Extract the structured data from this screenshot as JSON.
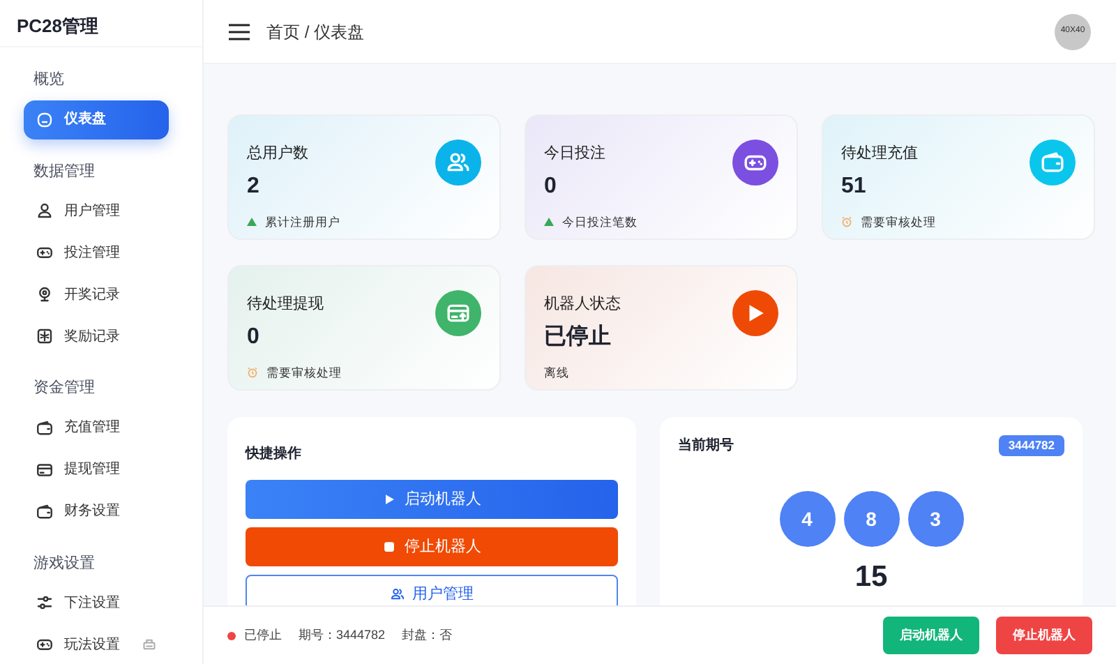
{
  "brand": "PC28管理",
  "sidebar": [
    {
      "title": "概览",
      "items": [
        {
          "label": "仪表盘",
          "selected": true
        }
      ]
    },
    {
      "title": "数据管理",
      "items": [
        {
          "label": "用户管理",
          "selected": false
        },
        {
          "label": "投注管理",
          "selected": false
        },
        {
          "label": "开奖记录",
          "selected": false
        },
        {
          "label": "奖励记录",
          "selected": false
        }
      ]
    },
    {
      "title": "资金管理",
      "items": [
        {
          "label": "充值管理",
          "selected": false
        },
        {
          "label": "提现管理",
          "selected": false
        },
        {
          "label": "财务设置",
          "selected": false
        }
      ]
    },
    {
      "title": "游戏设置",
      "items": [
        {
          "label": "下注设置",
          "selected": false
        },
        {
          "label": "玩法设置",
          "selected": false
        }
      ]
    }
  ],
  "breadcrumb": "首页 / 仪表盘",
  "avatar": "40X40",
  "stats": [
    {
      "title": "总用户数",
      "value": "2",
      "note": "累计注册用户",
      "kind": "up",
      "color": "#0ab4ea"
    },
    {
      "title": "今日投注",
      "value": "0",
      "note": "今日投注笔数",
      "kind": "up",
      "color": "#7b4fe0"
    },
    {
      "title": "待处理充值",
      "value": "51",
      "note": "需要审核处理",
      "kind": "pending",
      "color": "#0bc6ec"
    },
    {
      "title": "待处理提现",
      "value": "0",
      "note": "需要审核处理",
      "kind": "pending",
      "color": "#3fb46a"
    },
    {
      "title": "机器人状态",
      "value": "已停止",
      "note": "离线",
      "kind": "status",
      "color": "#ef4a05"
    }
  ],
  "quick": {
    "title": "快捷操作",
    "buttons": [
      {
        "label": "启动机器人",
        "kind": "primary"
      },
      {
        "label": "停止机器人",
        "kind": "danger"
      },
      {
        "label": "用户管理",
        "kind": "outline"
      }
    ]
  },
  "lottery": {
    "title": "当前期号",
    "issue": "3444782",
    "balls": [
      "4",
      "8",
      "3"
    ],
    "sum": "15"
  },
  "footer": {
    "running": false,
    "status": "已停止",
    "issue": "期号：3444782",
    "sealed": "封盘：否",
    "buttons": [
      {
        "label": "启动机器人",
        "kind": "start"
      },
      {
        "label": "停止机器人",
        "kind": "stop"
      }
    ]
  }
}
